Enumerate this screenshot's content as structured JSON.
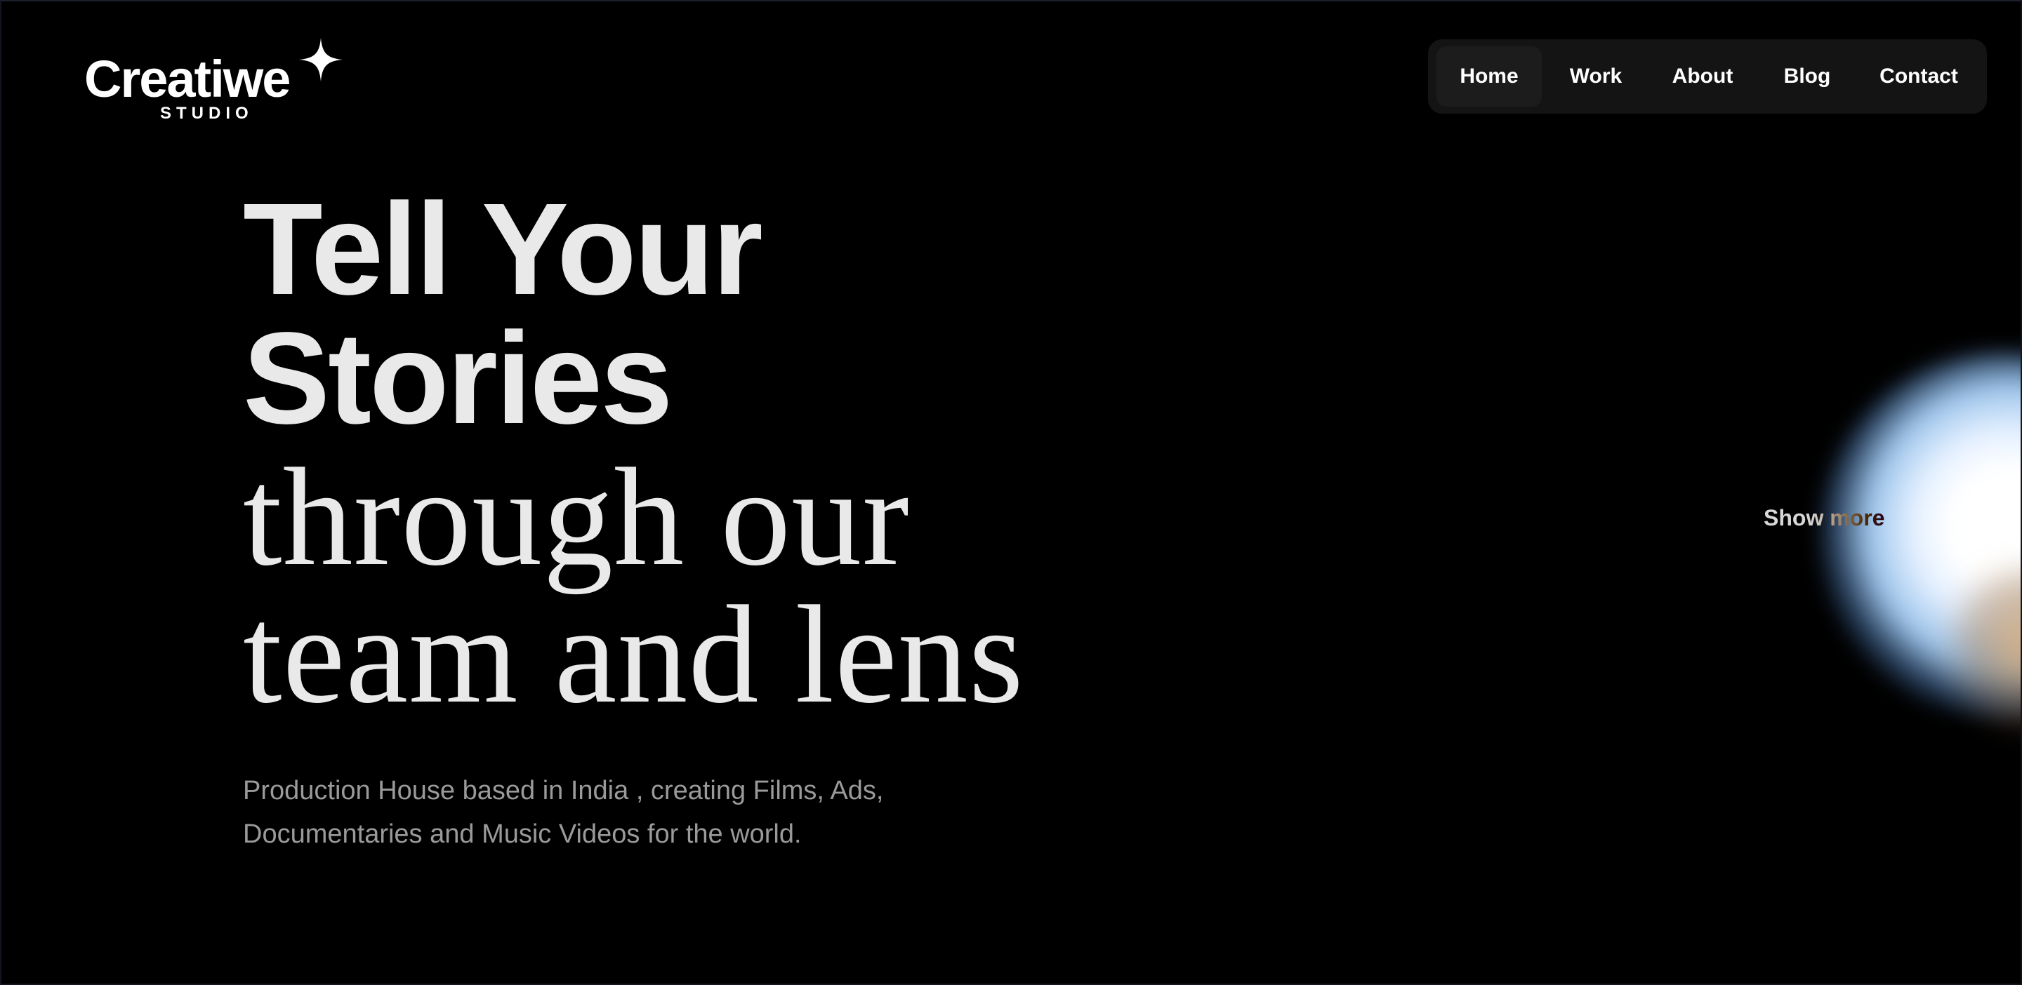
{
  "logo": {
    "word": "Creatiwe",
    "sub": "STUDIO",
    "icon": "sparkle-star-icon"
  },
  "nav": {
    "items": [
      {
        "label": "Home",
        "active": true
      },
      {
        "label": "Work",
        "active": false
      },
      {
        "label": "About",
        "active": false
      },
      {
        "label": "Blog",
        "active": false
      },
      {
        "label": "Contact",
        "active": false
      }
    ]
  },
  "hero": {
    "line1": "Tell Your",
    "line2": "Stories",
    "line3": "through our",
    "line4": "team and lens",
    "description_line1": "Production House based in India , creating Films, Ads,",
    "description_line2": "Documentaries and Music Videos for the world.",
    "show_more": "Show more"
  },
  "colors": {
    "background": "#000000",
    "nav_background": "#141414",
    "nav_active": "#1c1c1c",
    "headline": "#e9e9e9",
    "description": "#9a9a9a",
    "glow": "#cfe4ff"
  }
}
